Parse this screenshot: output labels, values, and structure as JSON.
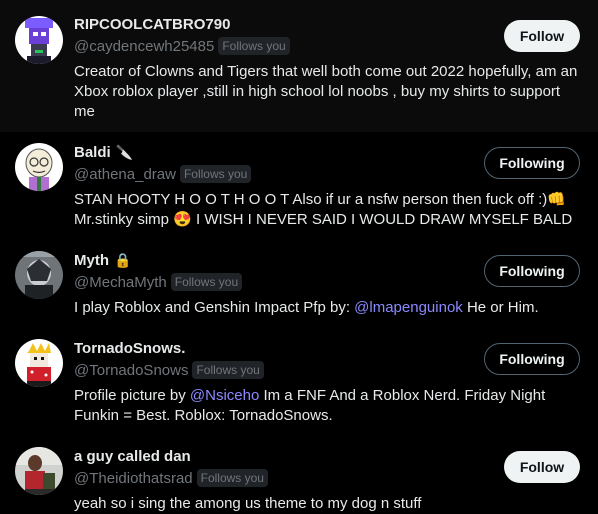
{
  "users": [
    {
      "name": "RIPCOOLCATBRO790",
      "badge_icon": "",
      "handle": "@caydencewh25485",
      "follows_you": "Follows you",
      "bio": [
        {
          "t": "Creator of Clowns and Tigers that well both come out 2022 hopefully, am an Xbox roblox player ,still in high school lol noobs , buy my shirts to support me"
        }
      ],
      "button": "Follow"
    },
    {
      "name": "Baldi",
      "badge_icon": "🔪",
      "handle": "@athena_draw",
      "follows_you": "Follows you",
      "bio": [
        {
          "t": "STAN HOOTY H O O T H O O T Also if ur a nsfw person then fuck off :)👊 Mr.stinky simp 😍 I WISH I NEVER SAID I WOULD DRAW MYSELF BALD"
        }
      ],
      "button": "Following"
    },
    {
      "name": "Myth",
      "badge_icon": "🔒",
      "handle": "@MechaMyth",
      "follows_you": "Follows you",
      "bio": [
        {
          "t": "I play Roblox and Genshin Impact Pfp by: "
        },
        {
          "t": "@lmapenguinok",
          "mention": true
        },
        {
          "t": " He or Him."
        }
      ],
      "button": "Following"
    },
    {
      "name": "TornadoSnows.",
      "badge_icon": "",
      "handle": "@TornadoSnows",
      "follows_you": "Follows you",
      "bio": [
        {
          "t": "Profile picture by "
        },
        {
          "t": "@Nsiceho",
          "mention": true
        },
        {
          "t": " Im a FNF And a Roblox Nerd. Friday Night Funkin = Best. Roblox: TornadoSnows."
        }
      ],
      "button": "Following"
    },
    {
      "name": "a guy called dan",
      "badge_icon": "",
      "handle": "@Theidiothatsrad",
      "follows_you": "Follows you",
      "bio": [
        {
          "t": "yeah so i sing the among us theme to my dog n stuff"
        }
      ],
      "button": "Follow"
    }
  ]
}
